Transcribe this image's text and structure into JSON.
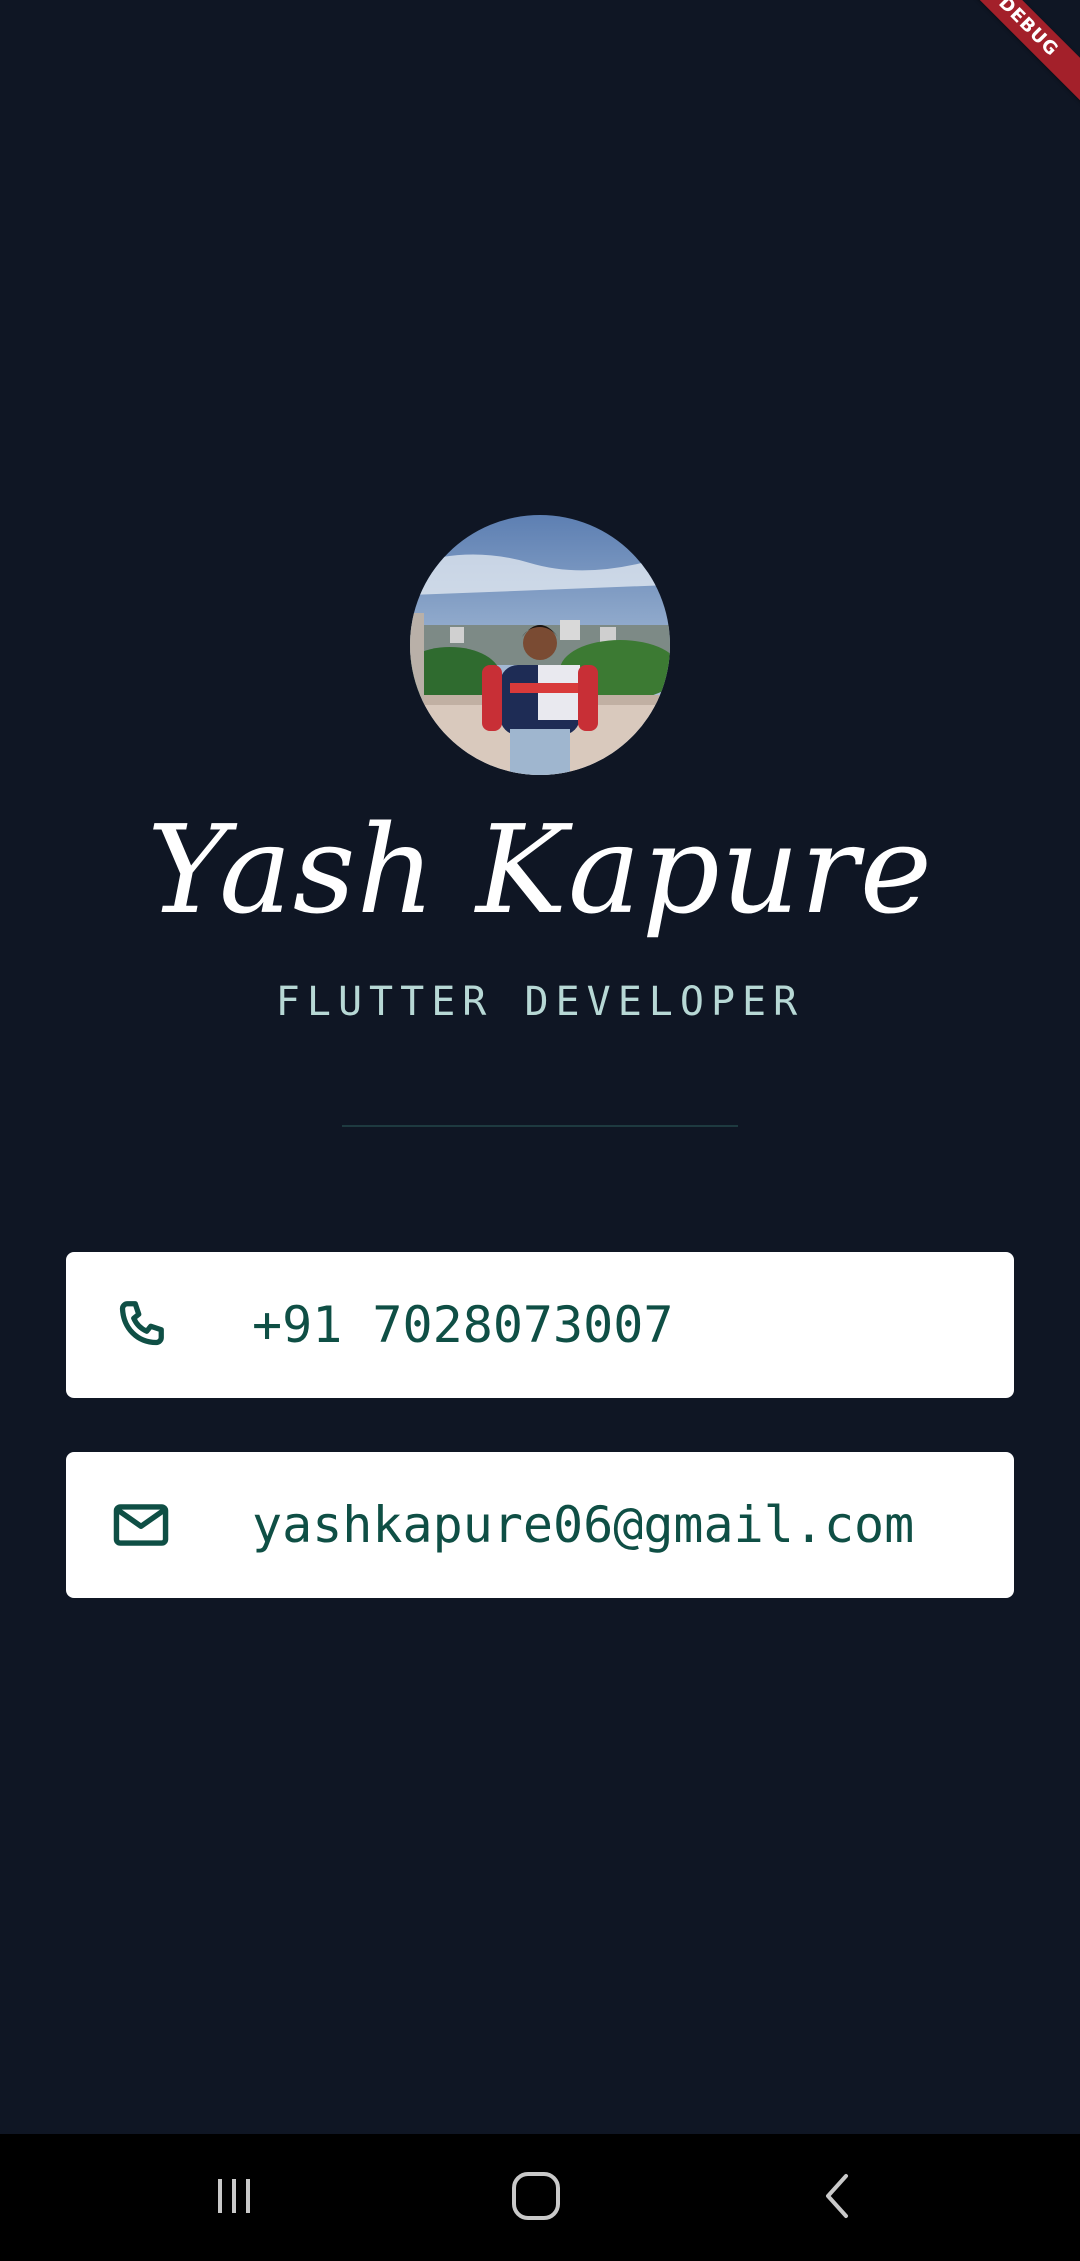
{
  "debug_banner": {
    "label": "DEBUG"
  },
  "profile": {
    "name": "Yash Kapure",
    "title": "FLUTTER DEVELOPER"
  },
  "contacts": [
    {
      "icon": "phone-icon",
      "value": "+91 7028073007"
    },
    {
      "icon": "mail-icon",
      "value": "yashkapure06@gmail.com"
    }
  ],
  "nav_bar": {
    "buttons": [
      "recent-apps-icon",
      "home-icon",
      "back-icon"
    ]
  },
  "colors": {
    "background": "#0f1624",
    "card": "#ffffff",
    "accent_teal": "#0f4f45",
    "subtitle": "#b7d8d5",
    "debug_red": "#a3202a"
  }
}
